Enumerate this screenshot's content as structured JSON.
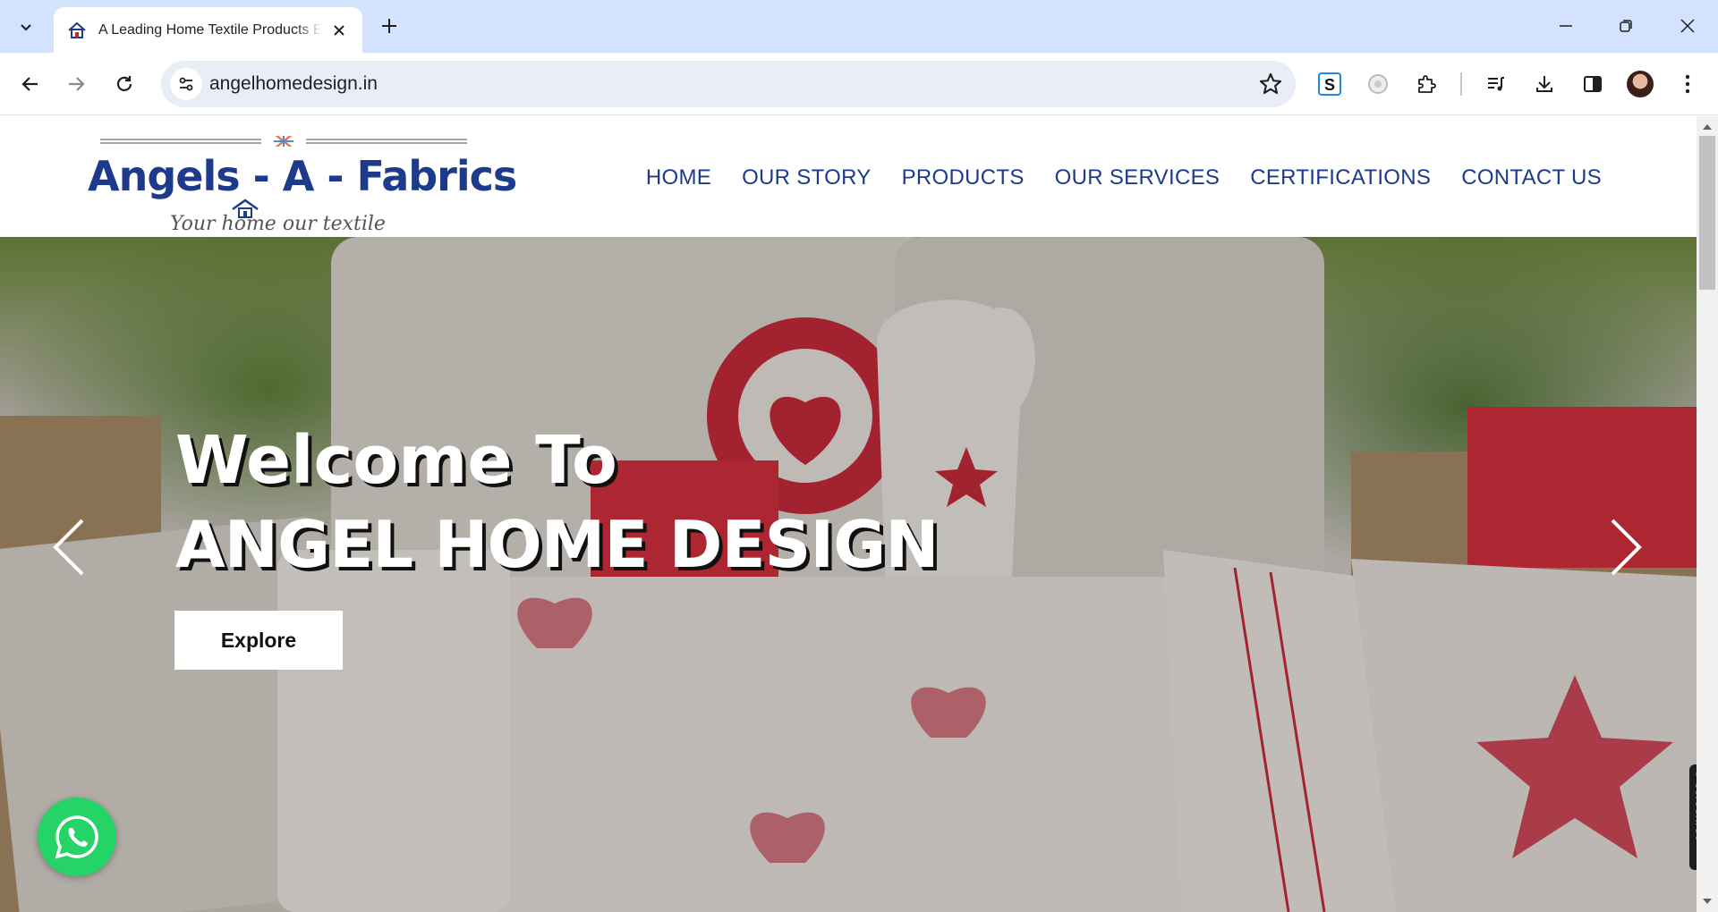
{
  "browser": {
    "tab": {
      "title": "A Leading Home Textile Products E"
    },
    "url": "angelhomedesign.in"
  },
  "site": {
    "logo": {
      "main": "Angels - A - Fabrics",
      "tagline": "Your home  our textile"
    },
    "nav": [
      "HOME",
      "OUR STORY",
      "PRODUCTS",
      "OUR SERVICES",
      "CERTIFICATIONS",
      "CONTACT US"
    ],
    "hero": {
      "line1": "Welcome To",
      "line2": "ANGEL HOME DESIGN",
      "button": "Explore"
    }
  },
  "screenrec": {
    "label": "screenrec"
  },
  "colors": {
    "brand_navy": "#1e3a8a",
    "whatsapp_green": "#25d366",
    "tabstrip": "#d3e3fd"
  },
  "icons": [
    "tab-search-icon",
    "home-favicon-icon",
    "close-icon",
    "plus-icon",
    "minimize-icon",
    "restore-icon",
    "window-close-icon",
    "back-icon",
    "forward-icon",
    "reload-icon",
    "site-info-icon",
    "star-icon",
    "extension-s-icon",
    "extension-camera-icon",
    "puzzle-icon",
    "media-icon",
    "download-icon",
    "side-panel-icon",
    "avatar",
    "menu-icon",
    "chevron-left-icon",
    "chevron-right-icon",
    "whatsapp-icon"
  ]
}
